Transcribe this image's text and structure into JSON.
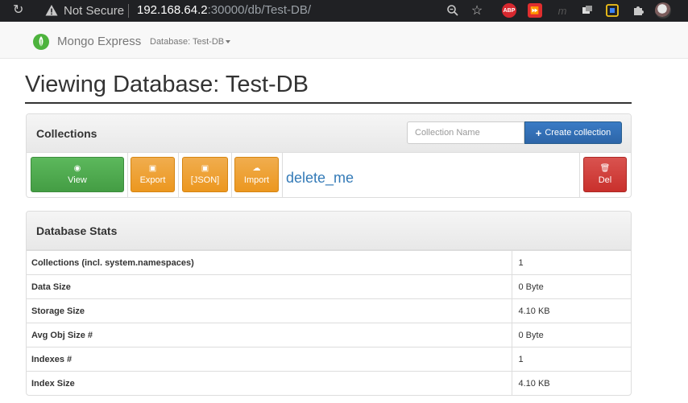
{
  "browser": {
    "security_label": "Not Secure",
    "url_host": "192.168.64.2",
    "url_rest": ":30000/db/Test-DB/",
    "extensions": [
      "zoom-icon",
      "star-icon",
      "adblock-icon",
      "red-extension-icon",
      "m-extension-icon",
      "dark-extension-icon",
      "yellow-extension-icon",
      "puzzle-icon",
      "profile-avatar"
    ],
    "abp_label": "ABP"
  },
  "navbar": {
    "brand": "Mongo Express",
    "database_menu": "Database: Test-DB"
  },
  "heading": "Viewing Database: Test-DB",
  "collections_panel": {
    "title": "Collections",
    "input_placeholder": "Collection Name",
    "create_button": "Create collection",
    "collection": {
      "name": "delete_me",
      "view_label": "View",
      "export_label": "Export",
      "json_label": "[JSON]",
      "import_label": "Import",
      "delete_label": "Del"
    }
  },
  "stats_panel": {
    "title": "Database Stats",
    "rows": [
      {
        "label": "Collections (incl. system.namespaces)",
        "value": "1"
      },
      {
        "label": "Data Size",
        "value": "0 Byte"
      },
      {
        "label": "Storage Size",
        "value": "4.10 KB"
      },
      {
        "label": "Avg Obj Size #",
        "value": "0 Byte"
      },
      {
        "label": "Indexes #",
        "value": "1"
      },
      {
        "label": "Index Size",
        "value": "4.10 KB"
      }
    ]
  },
  "colors": {
    "primary": "#337ab7",
    "success": "#5cb85c",
    "warning": "#f0ad4e",
    "danger": "#d9534f",
    "brand_leaf": "#4db33d"
  }
}
